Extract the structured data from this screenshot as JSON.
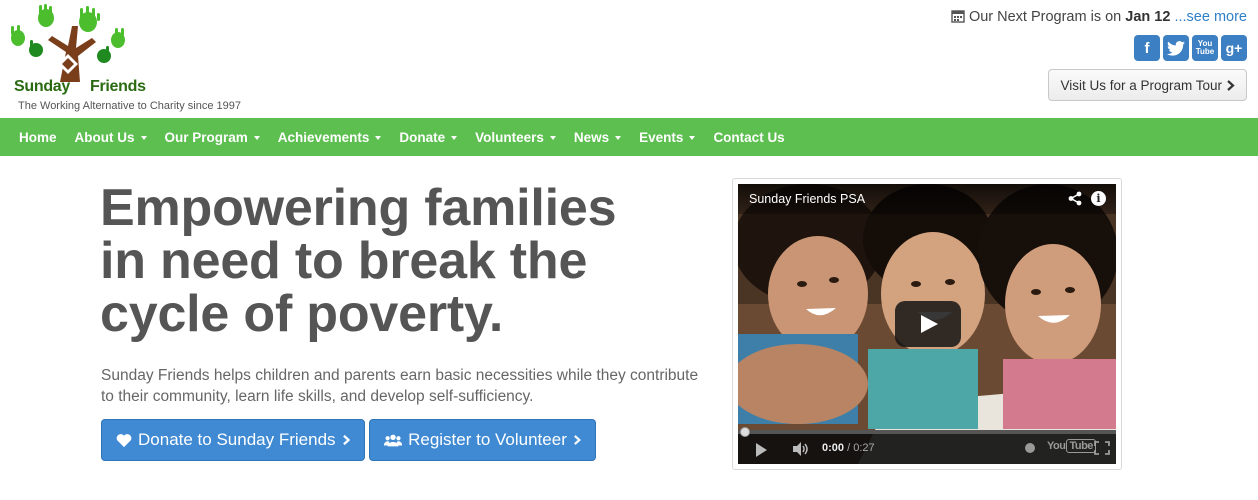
{
  "header": {
    "logo_name_left": "Sunday",
    "logo_name_right": "Friends",
    "tagline": "The Working Alternative to Charity since 1997",
    "next_program_prefix": "Our Next Program is on",
    "next_program_date": "Jan 12",
    "see_more": "...see more",
    "tour_button": "Visit Us for a Program Tour",
    "social": {
      "facebook": "f",
      "youtube_top": "You",
      "youtube_bottom": "Tube",
      "googleplus": "g+"
    }
  },
  "nav": {
    "items": [
      {
        "label": "Home",
        "dropdown": false
      },
      {
        "label": "About Us",
        "dropdown": true
      },
      {
        "label": "Our Program",
        "dropdown": true
      },
      {
        "label": "Achievements",
        "dropdown": true
      },
      {
        "label": "Donate",
        "dropdown": true
      },
      {
        "label": "Volunteers",
        "dropdown": true
      },
      {
        "label": "News",
        "dropdown": true
      },
      {
        "label": "Events",
        "dropdown": true
      },
      {
        "label": "Contact Us",
        "dropdown": false
      }
    ]
  },
  "hero": {
    "title_line1": "Empowering families",
    "title_line2": "in need to break the",
    "title_line3": "cycle of poverty.",
    "description": "Sunday Friends helps children and parents earn basic necessities while they contribute to their community, learn life skills, and develop self-sufficiency.",
    "donate_button": "Donate to Sunday Friends",
    "volunteer_button": "Register to Volunteer"
  },
  "video": {
    "title": "Sunday Friends PSA",
    "current_time": "0:00",
    "duration": "/ 0:27",
    "progress": 0,
    "youtube_left": "You",
    "youtube_right": "Tube"
  },
  "colors": {
    "nav_green": "#5cbf4f",
    "button_blue": "#3f8ad3",
    "link_blue": "#2f7fc8",
    "heading_gray": "#555555"
  }
}
